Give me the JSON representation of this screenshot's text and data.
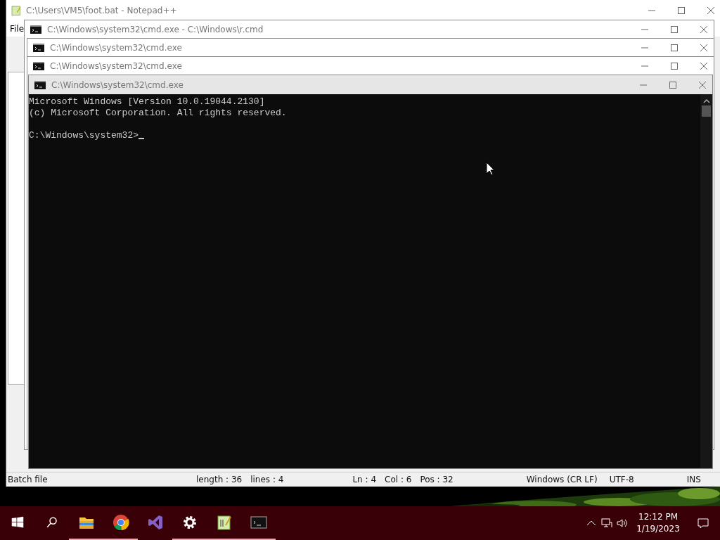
{
  "notepad_window": {
    "title": "C:\\Users\\VM5\\foot.bat - Notepad++",
    "menu": [
      "File"
    ],
    "status_bar": [
      {
        "text": "Batch file",
        "kind": "type"
      },
      {
        "text": "length : 36",
        "kind": "stat"
      },
      {
        "text": "lines : 4",
        "kind": "stat"
      },
      {
        "text": "Ln : 4",
        "kind": "line"
      },
      {
        "text": "Col : 6",
        "kind": "pos"
      },
      {
        "text": "Pos : 32",
        "kind": "pos"
      },
      {
        "text": "Windows (CR LF)",
        "kind": "eol"
      },
      {
        "text": "UTF-8",
        "kind": "enc"
      },
      {
        "text": "INS",
        "kind": "mode"
      }
    ]
  },
  "cmd_windows": [
    {
      "title": "C:\\Windows\\system32\\cmd.exe - C:\\Windows\\r.cmd",
      "active": false
    },
    {
      "title": "C:\\Windows\\system32\\cmd.exe",
      "active": false
    },
    {
      "title": "C:\\Windows\\system32\\cmd.exe",
      "active": false
    },
    {
      "title": "C:\\Windows\\system32\\cmd.exe",
      "active": true
    }
  ],
  "console": {
    "output": [
      "Microsoft Windows [Version 10.0.19044.2130]",
      "(c) Microsoft Corporation. All rights reserved."
    ],
    "prompt": "C:\\Windows\\system32>"
  },
  "taskbar": {
    "apps": [
      {
        "kind": "folder",
        "running": true
      },
      {
        "kind": "browser",
        "running": true
      },
      {
        "kind": "studio",
        "running": false
      },
      {
        "kind": "settings",
        "running": true
      },
      {
        "kind": "notepad",
        "running": true
      },
      {
        "kind": "terminal",
        "running": true
      }
    ],
    "clock": {
      "time": "12:12 PM",
      "date": "1/19/2023"
    }
  }
}
